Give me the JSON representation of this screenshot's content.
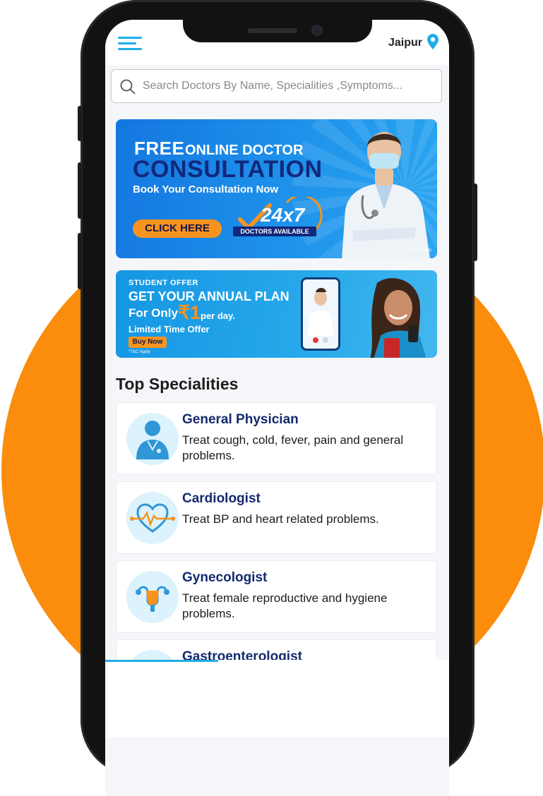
{
  "header": {
    "city": "Jaipur"
  },
  "search": {
    "placeholder": "Search Doctors By Name, Specialities ,Symptoms..."
  },
  "banner_consultation": {
    "free": "FREE",
    "online_doctor": "ONLINE DOCTOR",
    "consultation": "CONSULTATION",
    "book": "Book Your Consultation Now",
    "cta": "CLICK HERE",
    "hours": "24x7",
    "doctors_available": "DOCTORS AVAILABLE",
    "tc": "*T&C Apply"
  },
  "banner_student": {
    "tag": "STUDENT OFFER",
    "headline": "GET YOUR ANNUAL PLAN",
    "for_only": "For Only",
    "price": "₹1",
    "per_day": "per day.",
    "limited": "Limited Time Offer",
    "cta": "Buy Now",
    "tc": "*T&C Apply"
  },
  "specialities": {
    "title": "Top Specialities",
    "items": [
      {
        "name": "General Physician",
        "desc": "Treat cough, cold, fever, pain and general problems.",
        "icon": "physician-icon"
      },
      {
        "name": "Cardiologist",
        "desc": "Treat BP and heart related problems.",
        "icon": "heart-icon"
      },
      {
        "name": "Gynecologist",
        "desc": "Treat female reproductive and hygiene problems.",
        "icon": "uterus-icon"
      },
      {
        "name": "Gastroenterologist",
        "desc": "",
        "icon": "stomach-icon"
      }
    ]
  },
  "colors": {
    "accent": "#1eaee8",
    "background_circle": "#fb8c0c",
    "speciality_name": "#142a6e",
    "cta_orange": "#f7931e"
  }
}
